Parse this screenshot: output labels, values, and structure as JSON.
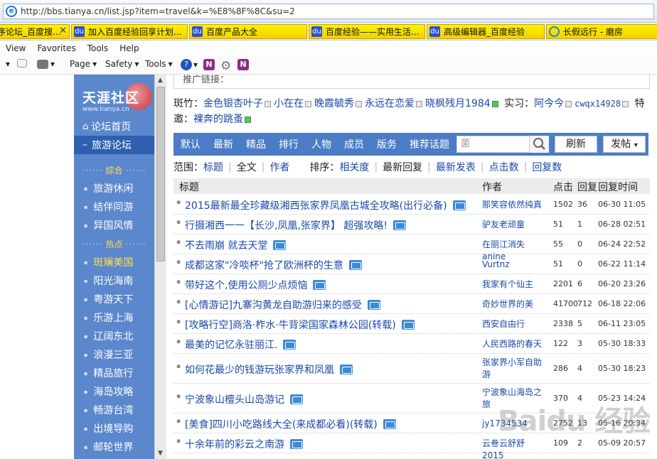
{
  "browser": {
    "url": "http://bbs.tianya.cn/list.jsp?item=travel&k=%E8%8F%8C&su=2"
  },
  "favorites": [
    {
      "label": "序论坛_百度搜...",
      "icon": "ie-icon"
    },
    {
      "label": "加入百度经验回享计划...",
      "icon": "paw-icon"
    },
    {
      "label": "百度产品大全",
      "icon": "paw-icon"
    },
    {
      "label": "百度经验——实用生活...",
      "icon": "paw-icon"
    },
    {
      "label": "高级编辑器_百度经验",
      "icon": "paw-icon"
    },
    {
      "label": "长假远行 - 磨房",
      "icon": "ie-icon"
    }
  ],
  "menu": [
    "View",
    "Favorites",
    "Tools",
    "Help"
  ],
  "cmdbar": {
    "page": "Page",
    "safety": "Safety",
    "tools": "Tools"
  },
  "nav": {
    "logo_text": "天涯社区",
    "logo_url": "www.tianya.cn",
    "home": "论坛首页",
    "current": "旅游论坛",
    "sec1": "综合",
    "sec1_items": [
      "旅游休闲",
      "结伴同游",
      "异国风情"
    ],
    "sec2": "热点",
    "sec2_items": [
      "斑斓美国",
      "阳光海南",
      "粤游天下",
      "乐游上海",
      "辽阔东北",
      "浪漫三亚",
      "精品旅行",
      "海岛攻略",
      "畅游台湾",
      "出境导购",
      "邮轮世界"
    ]
  },
  "content": {
    "promo": "推广链接：",
    "banzhu_label": "斑竹：",
    "banzhu": [
      "金色银杏叶子",
      "小在在",
      "晚霞毓秀",
      "永远在恋爱",
      "晓枫残月1984"
    ],
    "intern_label": "实习：",
    "intern": [
      "阿今今",
      "cwqx14928"
    ],
    "invite_label": "特邀：",
    "invite": [
      "裸奔的跳蚤"
    ],
    "tabs": [
      "默认",
      "最新",
      "精品",
      "排行",
      "人物",
      "成员",
      "版务",
      "推荐话题"
    ],
    "search_value": "菌",
    "refresh": "刷新",
    "post": "发帖",
    "range_label": "范围：",
    "range": [
      "标题",
      "全文",
      "作者"
    ],
    "sort_label": "排序：",
    "sort": [
      "相关度",
      "最新回复",
      "最新发表",
      "点击数",
      "回复数"
    ],
    "headers": {
      "title": "标题",
      "author": "作者",
      "clicks": "点击",
      "replies": "回复",
      "time": "回复时间"
    },
    "rows": [
      {
        "title": "2015最新最全珍藏级湘西张家界凤凰古城全攻略(出行必备)",
        "author": "那笑容依然纯真",
        "clicks": "1502",
        "replies": "36",
        "time": "06-30 11:05"
      },
      {
        "title": "行摄湘西一一【长沙,凤凰,张家界】 超强攻略!",
        "author": "驴友老顽童",
        "clicks": "51",
        "replies": "1",
        "time": "06-28 02:51"
      },
      {
        "title": "不去雨崩 就去天堂",
        "author": "在丽江消失anine",
        "clicks": "55",
        "replies": "0",
        "time": "06-24 22:52"
      },
      {
        "title": "成都这家\"冷啖杯\"抢了欧洲杯的生意",
        "author": "Vurtnz",
        "clicks": "51",
        "replies": "0",
        "time": "06-22 11:14"
      },
      {
        "title": "带好这个,使用公厕少点烦恼",
        "author": "我家有个仙主",
        "clicks": "2201",
        "replies": "6",
        "time": "06-20 23:26"
      },
      {
        "title": "[心情游记]九寨沟黄龙自助游归来的感受",
        "author": "奇妙世界的美",
        "clicks": "41700",
        "replies": "712",
        "time": "06-18 22:06"
      },
      {
        "title": "[攻略行空]商洛·柞水·牛背梁国家森林公园(转载)",
        "author": "西安自由行",
        "clicks": "2338",
        "replies": "5",
        "time": "06-11 23:05"
      },
      {
        "title": "最美的记忆永驻丽江.",
        "author": "人民西路的春天",
        "clicks": "122",
        "replies": "3",
        "time": "05-30 18:33"
      },
      {
        "title": "如何花最少的钱游玩张家界和凤凰",
        "author": "张家界小军自助游",
        "clicks": "286",
        "replies": "4",
        "time": "05-30 18:23"
      },
      {
        "title": "宁波象山檀头山岛游记",
        "author": "宁波象山海岛之旅",
        "clicks": "370",
        "replies": "4",
        "time": "05-23 14:24"
      },
      {
        "title": "[美食]四川小吃路线大全(来成都必看)(转载)",
        "author": "jy1734534",
        "clicks": "2752",
        "replies": "13",
        "time": "05-16 20:34"
      },
      {
        "title": "十余年前的彩云之南游",
        "author": "云卷云舒舒2015",
        "clicks": "109",
        "replies": "2",
        "time": "05-09 20:57"
      }
    ]
  },
  "watermark": "Baidu 经验"
}
